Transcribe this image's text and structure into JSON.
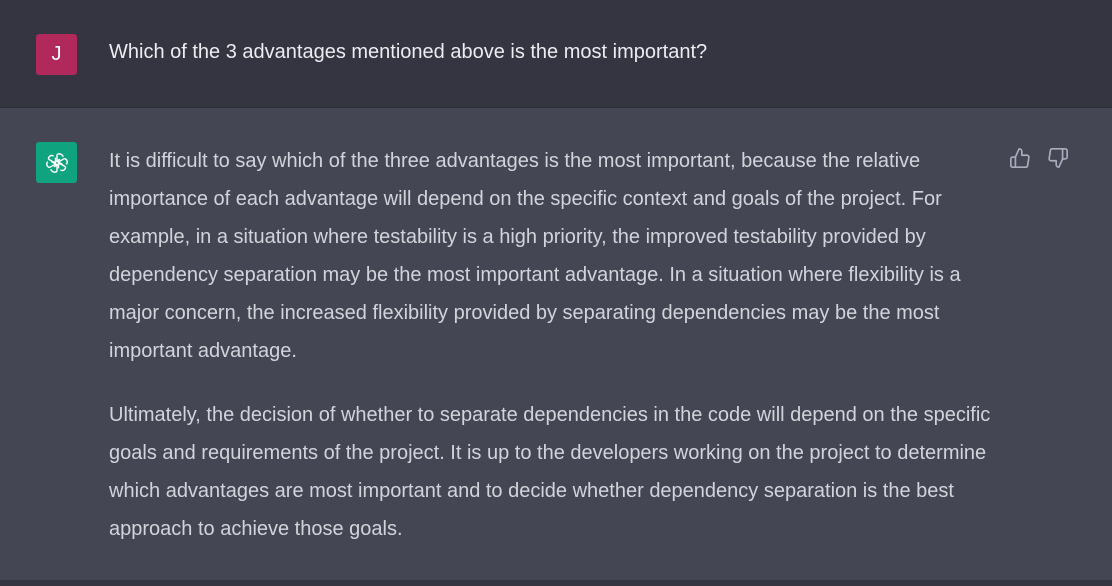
{
  "user_message": {
    "avatar_initial": "J",
    "avatar_color": "#b1285a",
    "text": "Which of the 3 advantages mentioned above is the most important?"
  },
  "assistant_message": {
    "avatar_icon": "openai-logo-icon",
    "avatar_color": "#10a37f",
    "paragraphs": [
      "It is difficult to say which of the three advantages is the most important, because the relative importance of each advantage will depend on the specific context and goals of the project. For example, in a situation where testability is a high priority, the improved testability provided by dependency separation may be the most important advantage. In a situation where flexibility is a major concern, the increased flexibility provided by separating dependencies may be the most important advantage.",
      "Ultimately, the decision of whether to separate dependencies in the code will depend on the specific goals and requirements of the project. It is up to the developers working on the project to determine which advantages are most important and to decide whether dependency separation is the best approach to achieve those goals."
    ],
    "feedback_icons": [
      "thumbs-up-icon",
      "thumbs-down-icon"
    ]
  },
  "colors": {
    "user_row_bg": "#343541",
    "assistant_row_bg": "#444654",
    "text_primary": "#ececf1",
    "text_secondary": "#d1d5db"
  }
}
